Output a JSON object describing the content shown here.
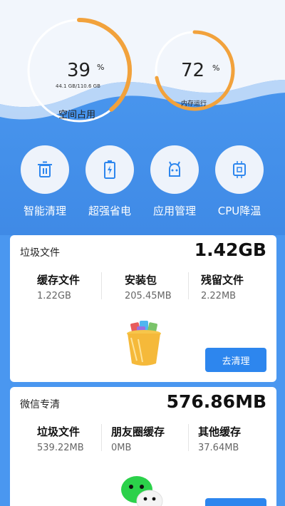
{
  "storage_gauge": {
    "value": "39",
    "unit": "%",
    "detail": "44.1 GB/110.6 GB",
    "label": "空间占用",
    "fraction": 0.39
  },
  "memory_gauge": {
    "value": "72",
    "unit": "%",
    "label": "内存运行",
    "fraction": 0.72
  },
  "tools": [
    {
      "label": "智能清理",
      "icon": "trash-icon"
    },
    {
      "label": "超强省电",
      "icon": "battery-icon"
    },
    {
      "label": "应用管理",
      "icon": "android-icon"
    },
    {
      "label": "CPU降温",
      "icon": "cpu-chip-icon"
    }
  ],
  "junk_card": {
    "title": "垃圾文件",
    "total": "1.42GB",
    "stats": [
      {
        "label": "缓存文件",
        "value": "1.22GB"
      },
      {
        "label": "安装包",
        "value": "205.45MB"
      },
      {
        "label": "残留文件",
        "value": "2.22MB"
      }
    ],
    "button": "去清理"
  },
  "wechat_card": {
    "title": "微信专清",
    "total": "576.86MB",
    "stats": [
      {
        "label": "垃圾文件",
        "value": "539.22MB"
      },
      {
        "label": "朋友圈缓存",
        "value": "0MB"
      },
      {
        "label": "其他缓存",
        "value": "37.64MB"
      }
    ]
  },
  "colors": {
    "accent_orange": "#f2a23c",
    "primary_blue": "#2d86ee",
    "background_blue": "#4a97f0",
    "wechat_green": "#2bd14a"
  }
}
